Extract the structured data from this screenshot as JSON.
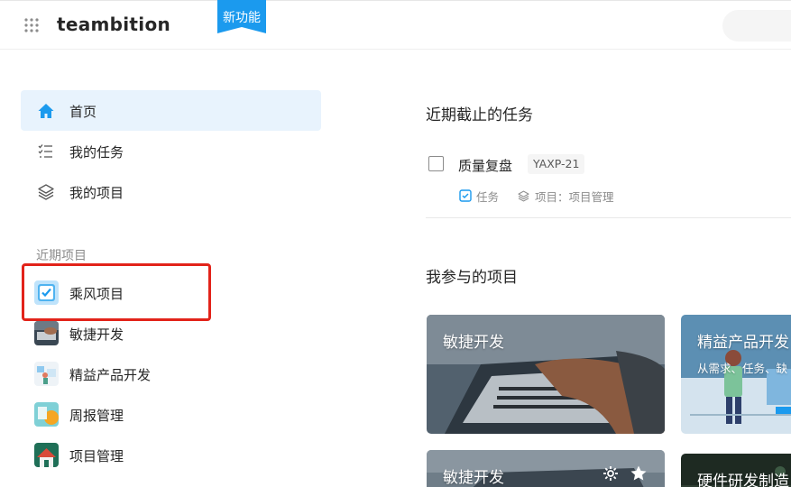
{
  "header": {
    "brand": "teambition",
    "new_badge": "新功能",
    "accent": "#1b9aee"
  },
  "sidebar": {
    "nav": [
      {
        "label": "首页",
        "icon": "home-icon",
        "active": true
      },
      {
        "label": "我的任务",
        "icon": "task-list-icon",
        "active": false
      },
      {
        "label": "我的项目",
        "icon": "layers-icon",
        "active": false
      }
    ],
    "recent_title": "近期项目",
    "recent_projects": [
      {
        "label": "乘风项目",
        "icon": "checkbox-project-icon"
      },
      {
        "label": "敏捷开发",
        "icon": "laptop-thumbnail"
      },
      {
        "label": "精益产品开发",
        "icon": "lean-thumbnail"
      },
      {
        "label": "周报管理",
        "icon": "report-thumbnail"
      },
      {
        "label": "项目管理",
        "icon": "house-thumbnail"
      }
    ]
  },
  "main": {
    "due_title": "近期截止的任务",
    "task": {
      "name": "质量复盘",
      "code": "YAXP-21",
      "type": "任务",
      "project": "项目：项目管理"
    },
    "projects_title": "我参与的项目",
    "cards": [
      {
        "title": "敏捷开发",
        "sub": ""
      },
      {
        "title": "精益产品开发",
        "sub": "从需求、任务、缺"
      },
      {
        "title": "敏捷开发",
        "sub": ""
      },
      {
        "title": "硬件研发制造",
        "sub": ""
      }
    ]
  }
}
